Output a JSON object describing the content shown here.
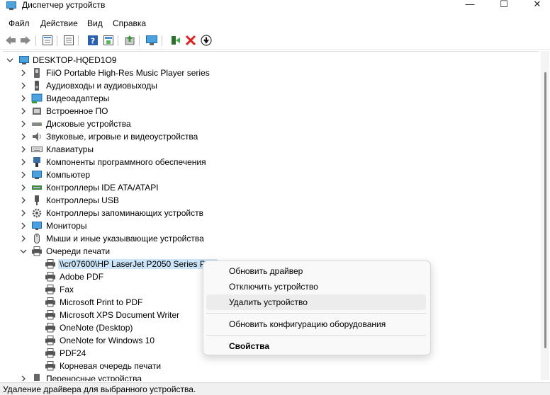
{
  "window": {
    "title": "Диспетчер устройств",
    "min_glyph": "—",
    "max_glyph": "☐",
    "close_glyph": "✕"
  },
  "menu": [
    "Файл",
    "Действие",
    "Вид",
    "Справка"
  ],
  "toolbar": [
    "back-icon",
    "forward-icon",
    "properties-icon",
    "show-hide-icon",
    "help-icon",
    "action-icon",
    "update-driver-icon",
    "scan-hardware-icon",
    "enable-device-icon",
    "uninstall-icon",
    "disable-icon"
  ],
  "tree": {
    "root": "DESKTOP-HQED1O9",
    "categories": [
      {
        "label": "FiiO Portable High-Res Music Player series",
        "icon": "usb-device-icon"
      },
      {
        "label": "Аудиовходы и аудиовыходы",
        "icon": "speaker-icon"
      },
      {
        "label": "Видеоадаптеры",
        "icon": "display-adapter-icon"
      },
      {
        "label": "Встроенное ПО",
        "icon": "firmware-icon"
      },
      {
        "label": "Дисковые устройства",
        "icon": "disk-drive-icon"
      },
      {
        "label": "Звуковые, игровые и видеоустройства",
        "icon": "sound-icon"
      },
      {
        "label": "Клавиатуры",
        "icon": "keyboard-icon"
      },
      {
        "label": "Компоненты программного обеспечения",
        "icon": "software-component-icon"
      },
      {
        "label": "Компьютер",
        "icon": "computer-icon"
      },
      {
        "label": "Контроллеры IDE ATA/ATAPI",
        "icon": "ide-controller-icon"
      },
      {
        "label": "Контроллеры USB",
        "icon": "usb-controller-icon"
      },
      {
        "label": "Контроллеры запоминающих устройств",
        "icon": "storage-controller-icon"
      },
      {
        "label": "Мониторы",
        "icon": "monitor-icon"
      },
      {
        "label": "Мыши и иные указывающие устройства",
        "icon": "mouse-icon"
      },
      {
        "label": "Очереди печати",
        "icon": "print-queue-icon",
        "expanded": true
      }
    ],
    "print_queue_children": [
      "\\\\cr07600\\HP LaserJet P2050 Series PCL",
      "Adobe PDF",
      "Fax",
      "Microsoft Print to PDF",
      "Microsoft XPS Document Writer",
      "OneNote (Desktop)",
      "OneNote for Windows 10",
      "PDF24",
      "Корневая очередь печати"
    ],
    "after": "Переносные устройства"
  },
  "context_menu": [
    {
      "label": "Обновить драйвер"
    },
    {
      "label": "Отключить устройство"
    },
    {
      "label": "Удалить устройство",
      "hover": true
    },
    {
      "label": "Обновить конфигурацию оборудования"
    },
    {
      "label": "Свойства",
      "bold": true
    }
  ],
  "status": "Удаление драйвера для выбранного устройства."
}
